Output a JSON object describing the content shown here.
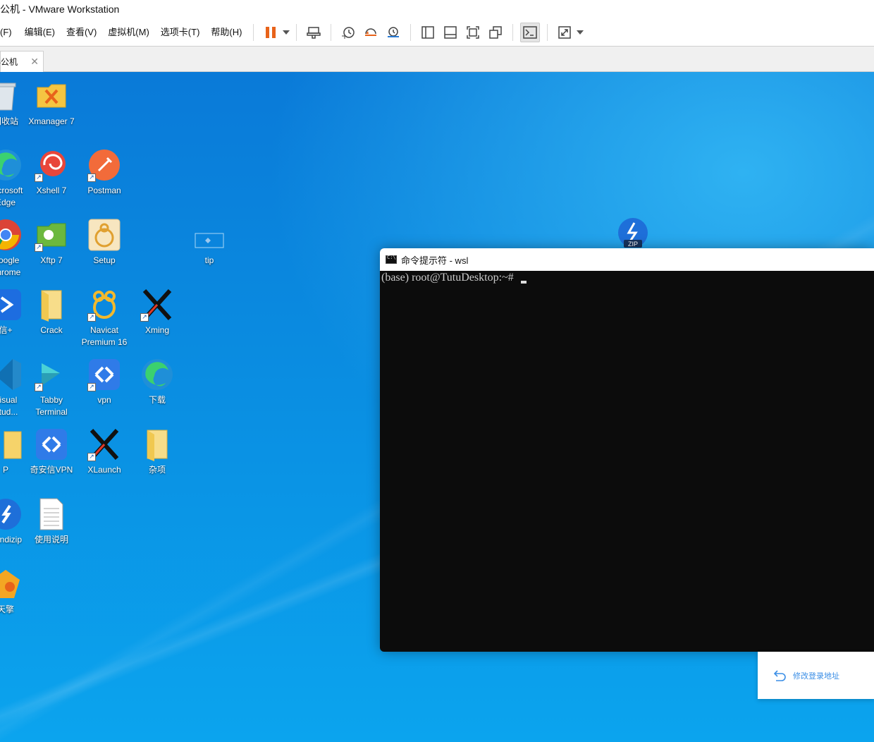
{
  "window": {
    "title": "办公机 - VMware Workstation",
    "title_visible": "办公机 - VMware Workstation"
  },
  "menu": [
    "(F)",
    "编辑(E)",
    "查看(V)",
    "虚拟机(M)",
    "选项卡(T)",
    "帮助(H)"
  ],
  "toolbar": {
    "buttons": [
      "pause-icon",
      "send-keys-icon",
      "snapshot-icon",
      "revert-snapshot-icon",
      "snapshot-manager-icon",
      "library-icon",
      "thumbnail-icon",
      "fullscreen-icon",
      "unity-icon",
      "console-icon",
      "stretch-icon"
    ],
    "accent": "#e8631a"
  },
  "tabs": [
    {
      "label": "办公机",
      "close": "✕"
    }
  ],
  "desktop": {
    "icons": {
      "recycle": "回收站",
      "xmanager": "Xmanager 7",
      "edge": "Microsoft\nEdge",
      "xshell": "Xshell 7",
      "postman": "Postman",
      "chrome": "Google\nChrome",
      "xftp": "Xftp 7",
      "setup": "Setup",
      "tip": "tip",
      "qax_plus": "信+",
      "crack": "Crack",
      "navicat": "Navicat\nPremium 16",
      "xming": "Xming",
      "vscode": "Visual\nStud...",
      "tabby": "Tabby\nTerminal",
      "vpn": "vpn",
      "download": "下载",
      "app_p": "P",
      "qax_vpn": "奇安信VPN",
      "xlaunch": "XLaunch",
      "misc": "杂项",
      "bandizip": "Bandizip",
      "readme": "使用说明",
      "tianqing": "天擎"
    }
  },
  "terminal": {
    "title": "命令提示符 - wsl",
    "prompt": "(base) root@TutuDesktop:~# "
  },
  "login_popup": {
    "link": "修改登录地址"
  }
}
